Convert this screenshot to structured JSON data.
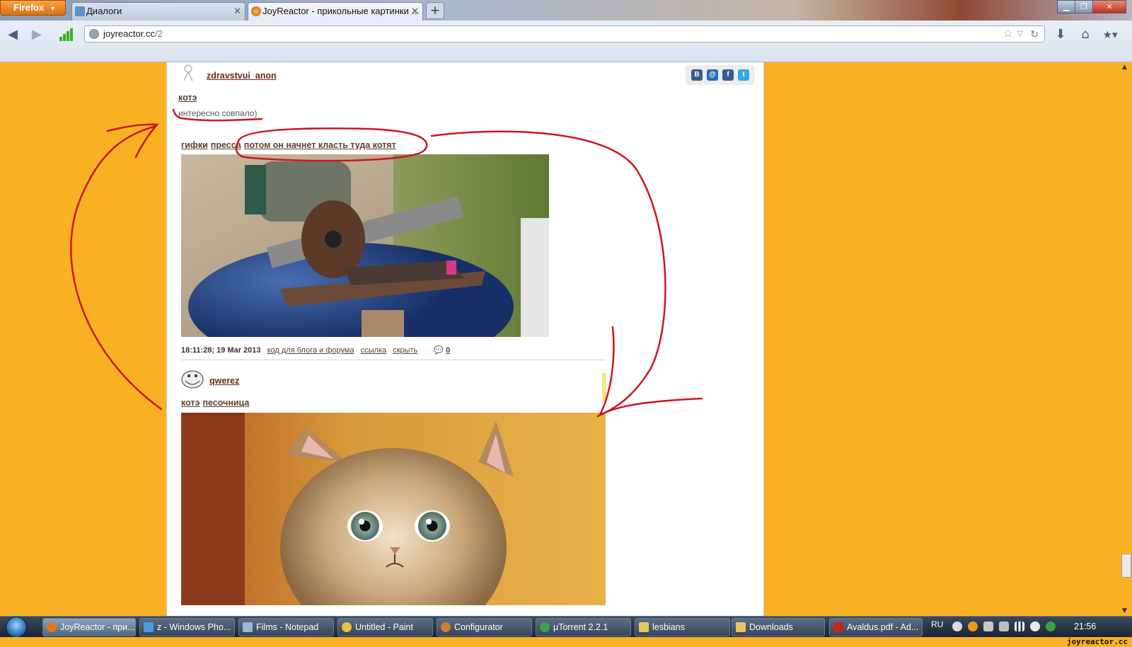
{
  "browser": {
    "menu_label": "Firefox",
    "tabs": [
      {
        "title": "Диалоги"
      },
      {
        "title": "JoyReactor - прикольные картинки ..."
      }
    ],
    "new_tab": "+",
    "url_host": "joyreactor.cc",
    "url_path": "/2"
  },
  "posts": [
    {
      "username": "zdravstvui_anon",
      "tags": [
        "котэ"
      ],
      "comment": "интересно совпало)"
    },
    {
      "tags": [
        "гифки",
        "пресса",
        "потом он начнет класть туда котят"
      ],
      "timestamp": "18:11:28; 19 Mar 2013",
      "links": [
        "код для блога и форума",
        "ссылка",
        "скрыть"
      ],
      "comment_count": "0"
    },
    {
      "username": "qwerez",
      "tags": [
        "котэ",
        "песочница"
      ]
    }
  ],
  "share_icons": [
    {
      "label": "B",
      "color": "#3a5a8a"
    },
    {
      "label": "@",
      "color": "#1e6fb8"
    },
    {
      "label": "f",
      "color": "#3b5998"
    },
    {
      "label": "t",
      "color": "#33a8e0"
    }
  ],
  "taskbar": {
    "items": [
      {
        "label": "JoyReactor - при...",
        "active": true,
        "icon_color": "#e07a1f"
      },
      {
        "label": "z - Windows Pho...",
        "icon_color": "#4e9bd8"
      },
      {
        "label": "Films - Notepad",
        "icon_color": "#9ab8d8"
      },
      {
        "label": "Untitled - Paint",
        "icon_color": "#f0c040"
      },
      {
        "label": "Configurator",
        "icon_color": "#d08030"
      },
      {
        "label": "µTorrent 2.2.1",
        "icon_color": "#3aa34a"
      },
      {
        "label": "lesbians",
        "icon_color": "#e8c760"
      },
      {
        "label": "Downloads",
        "icon_color": "#e8c760"
      },
      {
        "label": "Avaldus.pdf - Ad...",
        "icon_color": "#c0281c"
      }
    ],
    "language": "RU",
    "clock": "21:56"
  },
  "watermark": "joyreactor.cc"
}
